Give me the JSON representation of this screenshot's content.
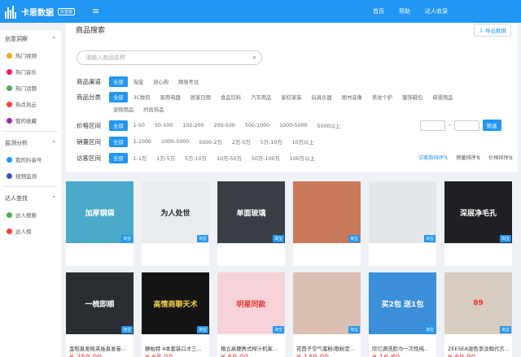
{
  "app": {
    "title": "卡思数据",
    "badge": "抖音版"
  },
  "topnav": [
    "首页",
    "帮助",
    "达人收录"
  ],
  "sidebar": {
    "groups": [
      {
        "label": "创意洞察",
        "items": [
          "热门视频",
          "热门音乐",
          "热门话题",
          "热点风云",
          "我的收藏"
        ]
      },
      {
        "label": "监测分析",
        "items": [
          "我的抖音号",
          "视频监测"
        ]
      },
      {
        "label": "达人查找",
        "items": [
          "达人搜索",
          "达人榜"
        ]
      }
    ],
    "icon_colors": [
      "#f5a623",
      "#e91e63",
      "#4caf50",
      "#f44336",
      "#9c27b0",
      "#2196f3",
      "#3f51b5",
      "#4caf50",
      "#f44336"
    ]
  },
  "panel": {
    "title": "商品搜索",
    "export_label": "导出数据",
    "search_placeholder": "请输入商品名称",
    "filters": [
      {
        "label": "商品渠道",
        "options": [
          "全部",
          "淘宝",
          "放心购",
          "网易考拉"
        ]
      },
      {
        "label": "商品分类",
        "options": [
          "全部",
          "3C数码",
          "家用电器",
          "居家日用",
          "食品饮料",
          "汽车用品",
          "家纺家装",
          "玩具乐器",
          "图书音像",
          "美妆个护",
          "服饰鞋包",
          "母婴用品"
        ]
      },
      {
        "label": "",
        "options": [
          "宠物用品",
          "时尚饰品"
        ]
      },
      {
        "label": "价格区间",
        "options": [
          "全部",
          "1-50",
          "50-100",
          "100-200",
          "200-500",
          "500-1000",
          "1000-5000",
          "5000以上"
        ]
      },
      {
        "label": "销量区间",
        "options": [
          "全部",
          "1-1000",
          "1000-5000",
          "5000-2万",
          "2万-5万",
          "5万-10万",
          "10万以上"
        ]
      },
      {
        "label": "访客区间",
        "options": [
          "全部",
          "1-1万",
          "1万-5万",
          "5万-10万",
          "10万-50万",
          "50万-100万",
          "100万以上"
        ]
      }
    ],
    "range_button": "筛选",
    "sorts": [
      "访客数排序",
      "销量排序",
      "价格排序"
    ]
  },
  "products": [
    {
      "name": "",
      "price": "",
      "img_text": "加厚钢袋",
      "img_bg": "#4aa8c9",
      "img_color": "#fff"
    },
    {
      "name": "",
      "price": "",
      "img_text": "为人处世",
      "img_bg": "#e9ecef",
      "img_color": "#222"
    },
    {
      "name": "",
      "price": "",
      "img_text": "单面玻璃",
      "img_bg": "#3a3f46",
      "img_color": "#fff"
    },
    {
      "name": "",
      "price": "",
      "img_text": "",
      "img_bg": "#c97a5a",
      "img_color": "#fff"
    },
    {
      "name": "",
      "price": "",
      "img_text": "",
      "img_bg": "#e3e7ea",
      "img_color": "#222"
    },
    {
      "name": "",
      "price": "",
      "img_text": "深层净毛孔",
      "img_bg": "#1e2024",
      "img_color": "#fff"
    },
    {
      "name": "金稻直发梳夹板直发卷...",
      "price": "¥ 259.00",
      "img_text": "一梳即顺",
      "img_bg": "#2a2d31",
      "img_color": "#fff"
    },
    {
      "name": "狮帕特 4本套装口才三...",
      "price": "¥ 68.00",
      "img_text": "高情商聊天术",
      "img_bg": "#151515",
      "img_color": "#f7d24a"
    },
    {
      "name": "格立高便携式榨汁机家...",
      "price": "¥ 69.00",
      "img_text": "明星同款",
      "img_bg": "#f6d3d8",
      "img_color": "#e53935"
    },
    {
      "name": "花西子空气蜜粉/散粉定...",
      "price": "¥ 149.00",
      "img_text": "",
      "img_bg": "#d9c0b2",
      "img_color": "#fff"
    },
    {
      "name": "欣亿源洗脸巾一次性纯...",
      "price": "¥ 16.80",
      "img_text": "买2包 送1包",
      "img_bg": "#3b8fd9",
      "img_color": "#fff"
    },
    {
      "name": "ZEESEA滋色李汶翰代言...",
      "price": "¥ 69.90",
      "img_text": "89",
      "img_bg": "#d8ccc0",
      "img_color": "#e53935"
    }
  ],
  "badge_label": "淘宝"
}
